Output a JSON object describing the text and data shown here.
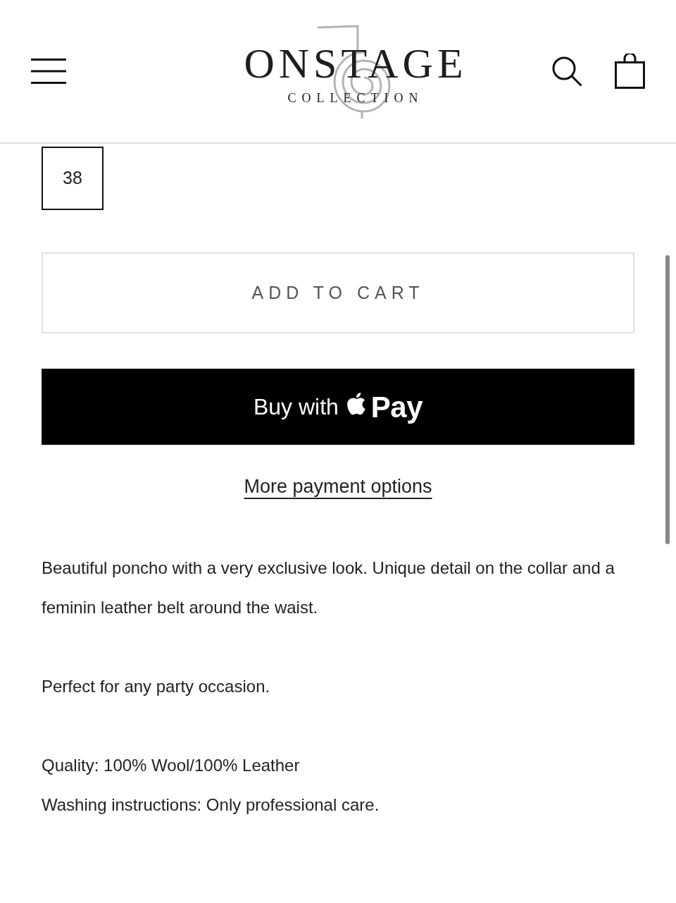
{
  "header": {
    "logo": {
      "title": "ONSTAGE",
      "subtitle": "COLLECTION"
    }
  },
  "sizes": [
    {
      "label": "38",
      "selected": true
    }
  ],
  "add_to_cart": {
    "label": "ADD TO CART"
  },
  "apple_pay_button": {
    "prefix": "Buy with",
    "brand": "Pay"
  },
  "more_payment_link": {
    "label": "More payment options"
  },
  "description": {
    "paragraphs": [
      {
        "lines": [
          "Beautiful poncho with a very exclusive look. Unique detail on the collar and a feminin leather belt around the waist."
        ]
      },
      {
        "lines": [
          "Perfect for any party occasion."
        ]
      },
      {
        "lines": [
          "Quality: 100% Wool/100% Leather",
          "Washing instructions: Only professional care."
        ]
      }
    ]
  }
}
